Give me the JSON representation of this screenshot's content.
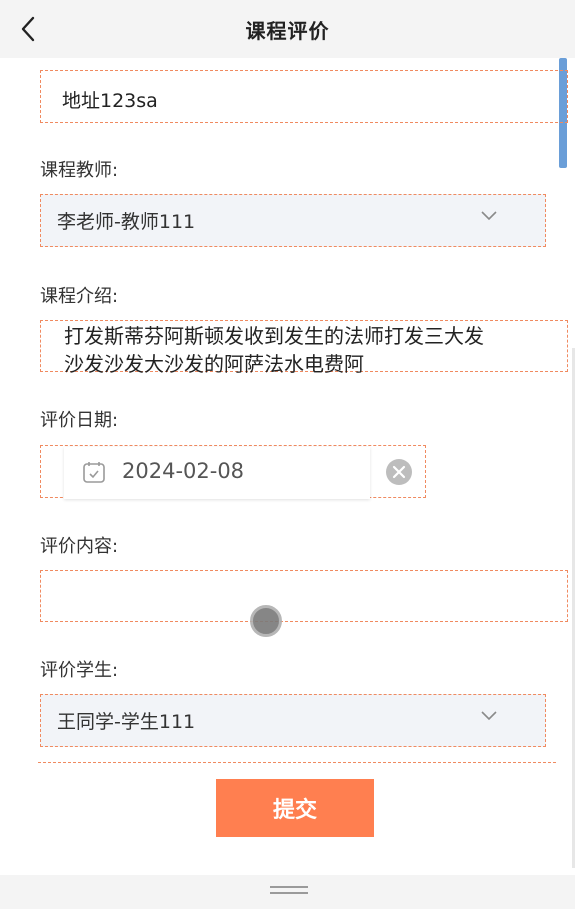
{
  "header": {
    "title": "课程评价"
  },
  "address": {
    "value": "地址123sa"
  },
  "teacher": {
    "label": "课程教师:",
    "selected": "李老师-教师111"
  },
  "intro": {
    "label": "课程介绍:",
    "text": "打发斯蒂芬阿斯顿发收到发生的法师打发三大发沙发沙发大沙发的阿萨法水电费阿"
  },
  "eval_date": {
    "label": "评价日期:",
    "value": "2024-02-08"
  },
  "eval_content": {
    "label": "评价内容:",
    "value": ""
  },
  "student": {
    "label": "评价学生:",
    "selected": "王同学-学生111"
  },
  "submit": {
    "label": "提交"
  },
  "colors": {
    "accent": "#ff7f50",
    "dashed": "#f08a60",
    "scrollbar": "#6a9ed8"
  }
}
